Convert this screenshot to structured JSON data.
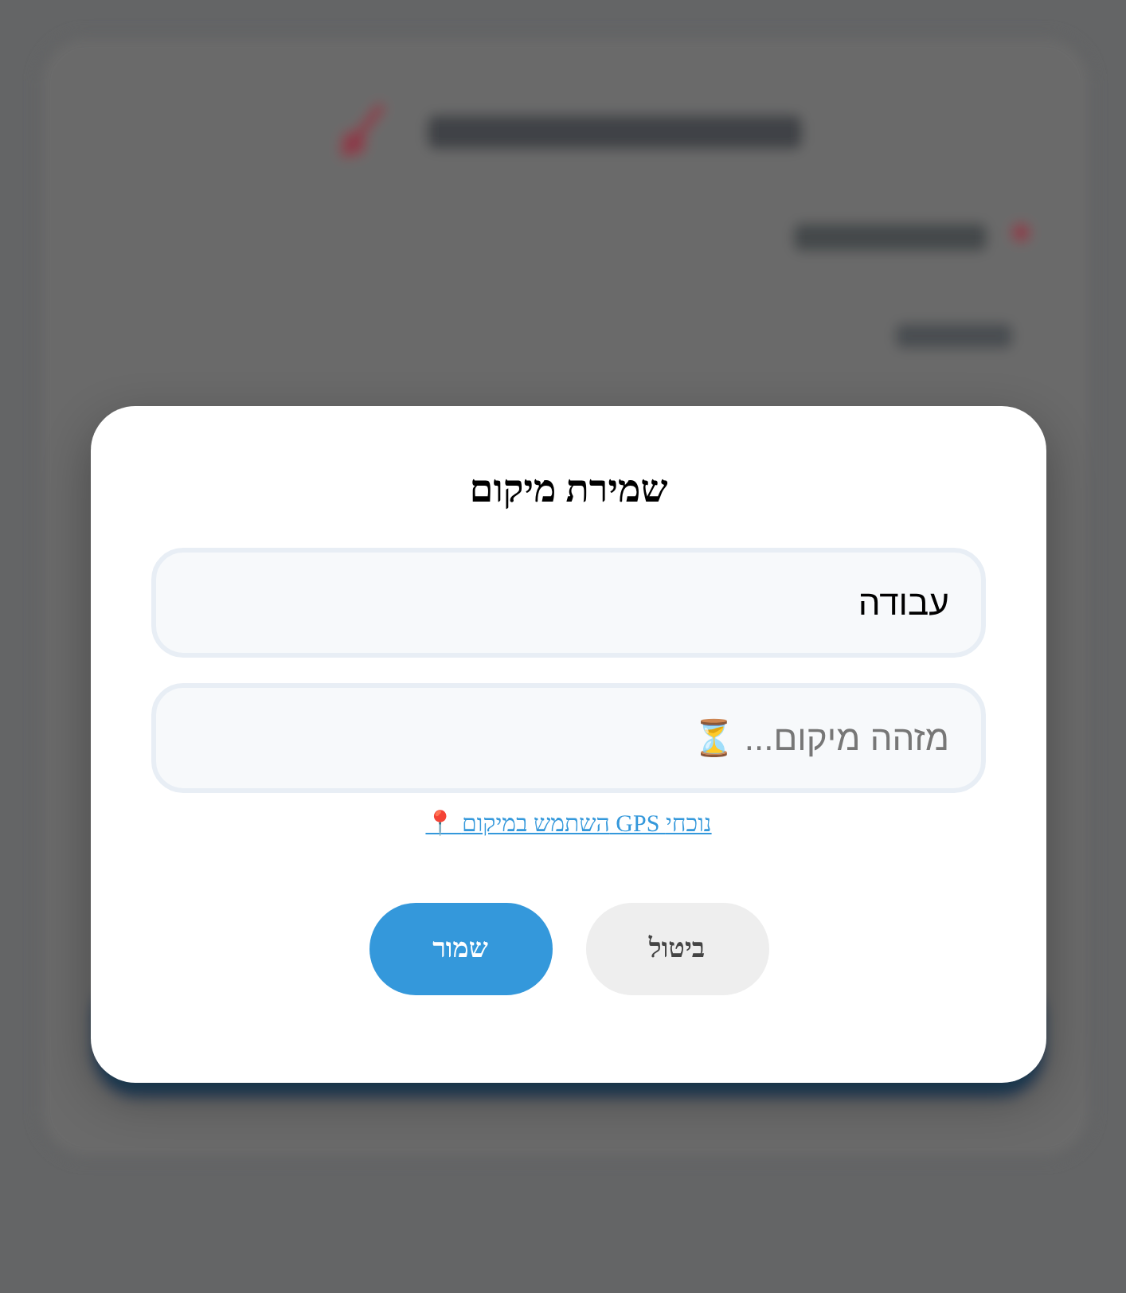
{
  "dialog": {
    "title": "שמירת מיקום",
    "fields": [
      {
        "kind": "value",
        "value": "עבודה"
      },
      {
        "kind": "placeholder",
        "placeholder": "מזהה מיקום... ⏳"
      }
    ],
    "link": "📍 השתמש במיקום GPS נוכחי",
    "buttons": [
      {
        "kind": "secondary",
        "label": "ביטול"
      },
      {
        "kind": "primary",
        "label": "שמור"
      }
    ]
  }
}
